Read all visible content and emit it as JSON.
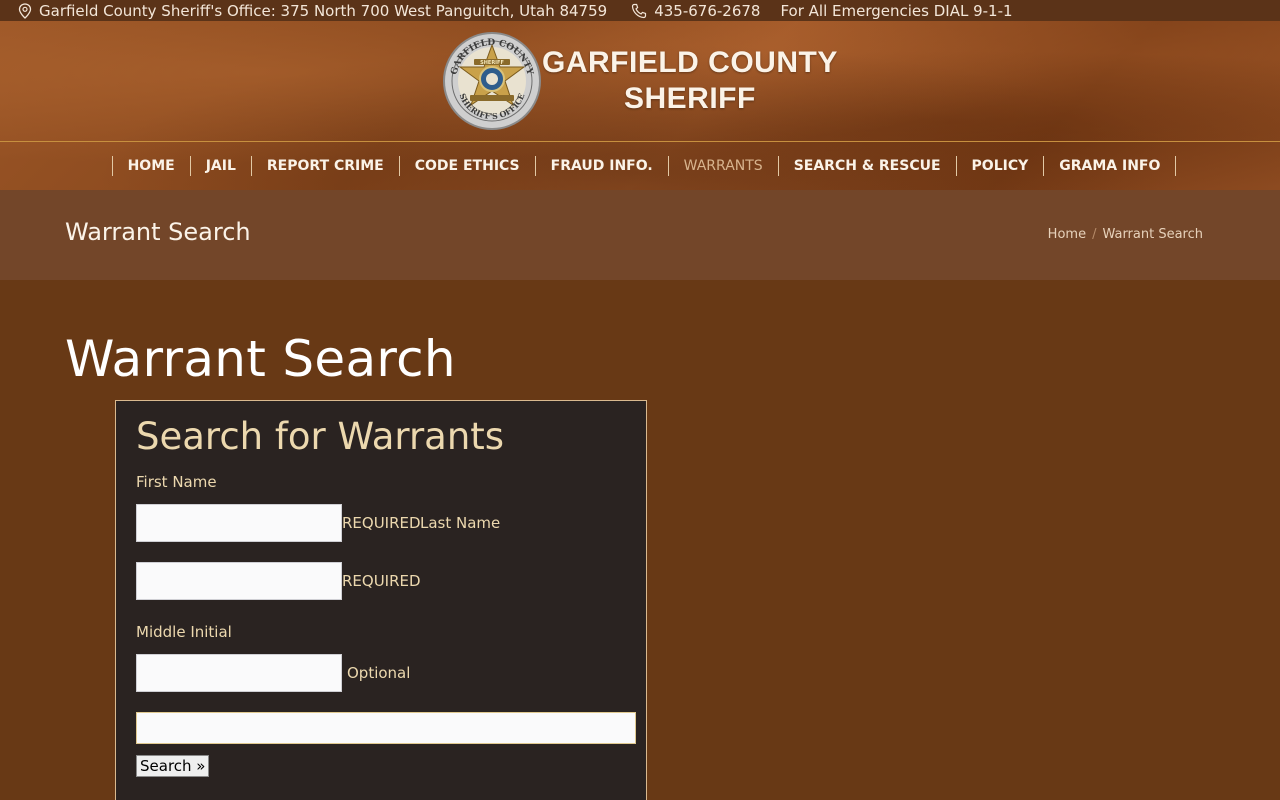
{
  "topbar": {
    "address": "Garfield County Sheriff's Office: 375 North 700 West Panguitch, Utah 84759",
    "phone": "435-676-2678",
    "emergency": "For All Emergencies DIAL 9-1-1",
    "location_icon": "map-pin-icon",
    "phone_icon": "phone-icon"
  },
  "header": {
    "title_line1": "GARFIELD COUNTY",
    "title_line2": "SHERIFF",
    "badge_top_text": "GARFIELD COUNTY",
    "badge_bottom_text": "SHERIFF'S OFFICE",
    "badge_center_text": "SHERIFF"
  },
  "nav": {
    "items": [
      {
        "label": "HOME"
      },
      {
        "label": "JAIL"
      },
      {
        "label": "REPORT CRIME"
      },
      {
        "label": "CODE ETHICS"
      },
      {
        "label": "FRAUD INFO."
      },
      {
        "label": "WARRANTS"
      },
      {
        "label": "SEARCH & RESCUE"
      },
      {
        "label": "POLICY"
      },
      {
        "label": "GRAMA INFO"
      }
    ],
    "active": "WARRANTS"
  },
  "title_band": {
    "title": "Warrant Search",
    "breadcrumb_home": "Home",
    "breadcrumb_current": "Warrant Search"
  },
  "main": {
    "heading": "Warrant Search"
  },
  "form": {
    "title": "Search for Warrants",
    "first_name_label": "First Name",
    "first_name_value": "",
    "required_text_1": "REQUIRED",
    "last_name_label": "Last Name",
    "last_name_value": "",
    "required_text_2": "REQUIRED",
    "middle_initial_label": "Middle Initial",
    "middle_initial_value": "",
    "optional_text": "Optional",
    "extra_value": "",
    "search_button": "Search »"
  },
  "colors": {
    "page_bg": "#683915",
    "topbar_bg": "#5b3318",
    "band_bg": "#734629",
    "form_bg": "#2a2321",
    "form_text": "#ecd8ae",
    "nav_active": "#d8b48e"
  }
}
